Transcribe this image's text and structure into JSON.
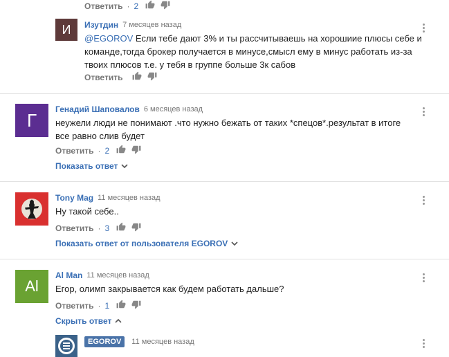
{
  "top_fragment": {
    "reply_label": "Ответить",
    "count": "2"
  },
  "reply_izutdin": {
    "avatar_letter": "И",
    "avatar_color": "#5e3a3a",
    "author": "Изутдин",
    "time": "7 месяцев назад",
    "mention": "@EGOROV",
    "text": " Если тебе дают 3% и ты рассчитываешь на хорошиие плюсы себе и команде,тогда брокер получается в минусе,смысл ему в минус работать из-за твоих плюсов т.е. у тебя в группе больше 3к сабов",
    "reply_label": "Ответить"
  },
  "comments": [
    {
      "avatar_letter": "Г",
      "avatar_color": "#5b2d91",
      "author": "Генадий Шаповалов",
      "time": "6 месяцев назад",
      "text": "неужели люди не понимают .что нужно бежать от таких *спецов*.результат в итоге все равно слив будет",
      "reply_label": "Ответить",
      "likes": "2",
      "replies_toggle": "Показать ответ"
    },
    {
      "avatar_letter": "",
      "avatar_color": "#d9302f",
      "author": "Tony Mag",
      "time": "11 месяцев назад",
      "text": "Ну такой себе..",
      "reply_label": "Ответить",
      "likes": "3",
      "replies_toggle": "Показать ответ от пользователя EGOROV"
    },
    {
      "avatar_letter": "Al",
      "avatar_color": "#6aa232",
      "author": "Al Man",
      "time": "11 месяцев назад",
      "text": "Егор, олимп закрывается как будем работать дальше?",
      "reply_label": "Ответить",
      "likes": "1",
      "replies_toggle": "Скрыть ответ"
    }
  ],
  "reply_egorov": {
    "author": "EGOROV",
    "time": "11 месяцев назад"
  }
}
